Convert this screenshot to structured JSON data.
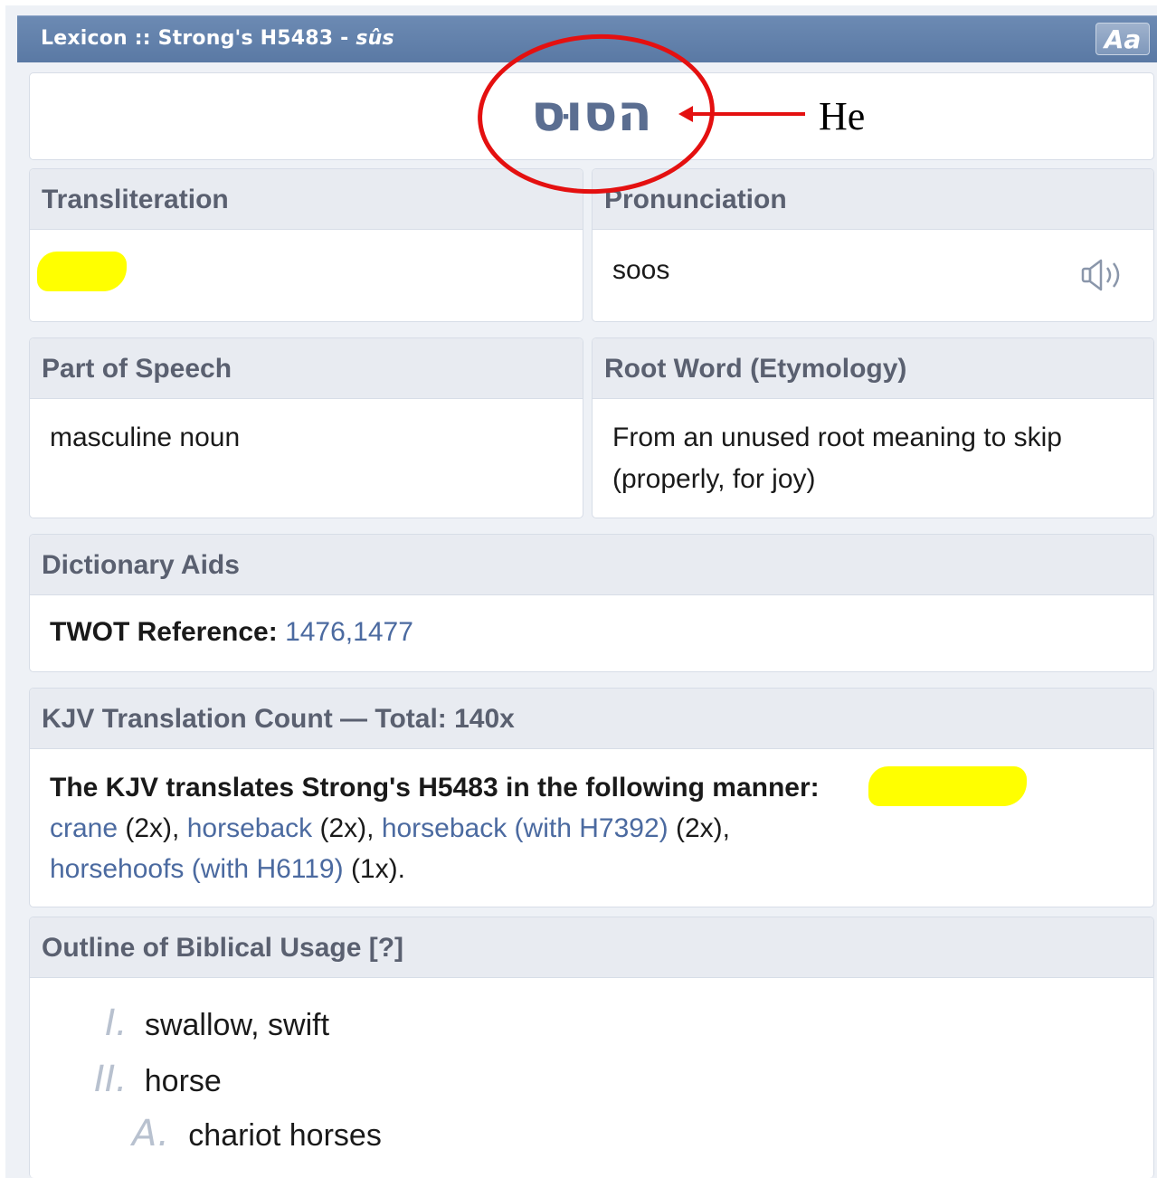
{
  "window": {
    "title_prefix": "Lexicon :: Strong's H5483 - ",
    "title_translit": "sûs",
    "font_button": "Aa"
  },
  "word": {
    "hebrew": "הסוּס"
  },
  "annotation": {
    "label": "He",
    "color": "#e41010"
  },
  "transliteration": {
    "heading": "Transliteration"
  },
  "pronunciation": {
    "heading": "Pronunciation",
    "value": "soos",
    "icon": "speaker-icon"
  },
  "part_of_speech": {
    "heading": "Part of Speech",
    "value": "masculine noun"
  },
  "root_word": {
    "heading": "Root Word (Etymology)",
    "line1": "From an unused root meaning to skip",
    "line2": "(properly, for joy)"
  },
  "dictionary_aids": {
    "heading": "Dictionary Aids",
    "twot_label": "TWOT Reference:",
    "twot_value": "1476,1477"
  },
  "kjv": {
    "heading": "KJV Translation Count — Total: 140x",
    "intro": "The KJV translates Strong's H5483 in the following manner:",
    "after_redaction": "),",
    "items": [
      {
        "term": "crane",
        "count": " (2x), "
      },
      {
        "term": "horseback",
        "count": " (2x), "
      },
      {
        "term": "horseback (with H7392)",
        "count": " (2x),"
      },
      {
        "term": "horsehoofs (with H6119)",
        "count": " (1x)."
      }
    ]
  },
  "outline": {
    "heading": "Outline of Biblical Usage [?]",
    "items": [
      {
        "marker": "I.",
        "text": "swallow, swift"
      },
      {
        "marker": "II.",
        "text": "horse"
      },
      {
        "marker": "A.",
        "text": "chariot horses"
      }
    ]
  },
  "colors": {
    "title_bar": "#5a79a4",
    "panel_header": "#e8ebf1",
    "link": "#4b6aa0",
    "highlight": "#ffff00"
  }
}
